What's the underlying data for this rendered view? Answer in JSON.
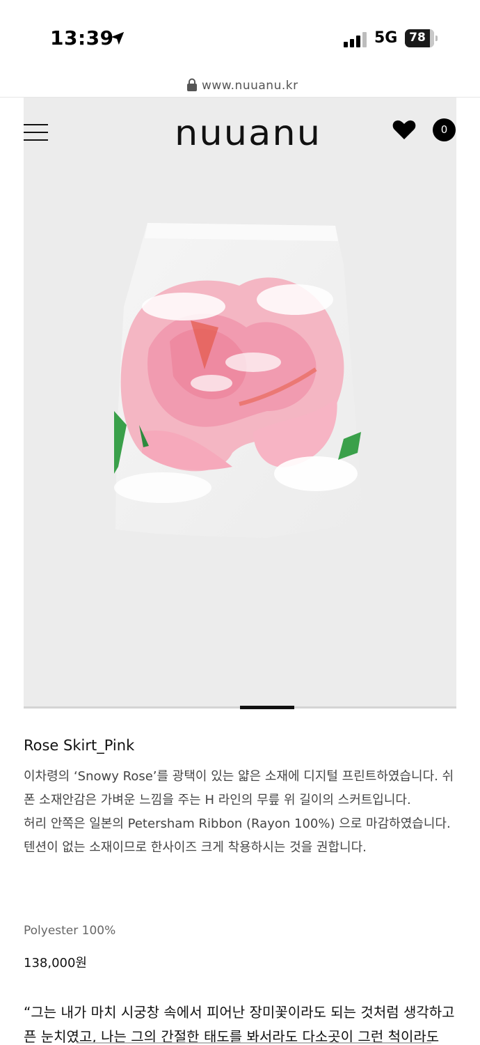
{
  "status_bar": {
    "time": "13:39",
    "network": "5G",
    "battery": "78",
    "icons": [
      "location-arrow-icon",
      "signal-icon",
      "battery-icon"
    ]
  },
  "browser": {
    "url": "www.nuuanu.kr",
    "icon": "lock-icon"
  },
  "header": {
    "logo": "nuuanu",
    "cart_count": "0",
    "icons": [
      "menu-icon",
      "heart-icon",
      "cart-icon"
    ]
  },
  "product": {
    "name": "Rose Skirt_Pink",
    "description": [
      "이차령의 ‘Snowy Rose’를 광택이 있는 얇은 소재에 디지털 프린트하였습니다. 쉬폰 소재안감은 가벼운 느낌을 주는 H 라인의 무릎 위 길이의 스커트입니다.",
      "허리 안쪽은 일본의 Petersham Ribbon (Rayon 100%) 으로 마감하였습니다.",
      "텐션이 없는 소재이므로 한사이즈 크게 착용하시는 것을 권합니다."
    ],
    "material": "Polyester 100%",
    "price": "138,000원",
    "quote": "“그는 내가 마치 시궁창 속에서 피어난 장미꽃이라도 되는 것처럼 생각하고픈 눈치였고, 나는 그의 간절한 태도를 봐서라도 다소곳이 그런 척이라도"
  },
  "colors": {
    "hero_bg": "#ececec",
    "accent": "#111111",
    "rose_pink": "#f2a3b3"
  }
}
